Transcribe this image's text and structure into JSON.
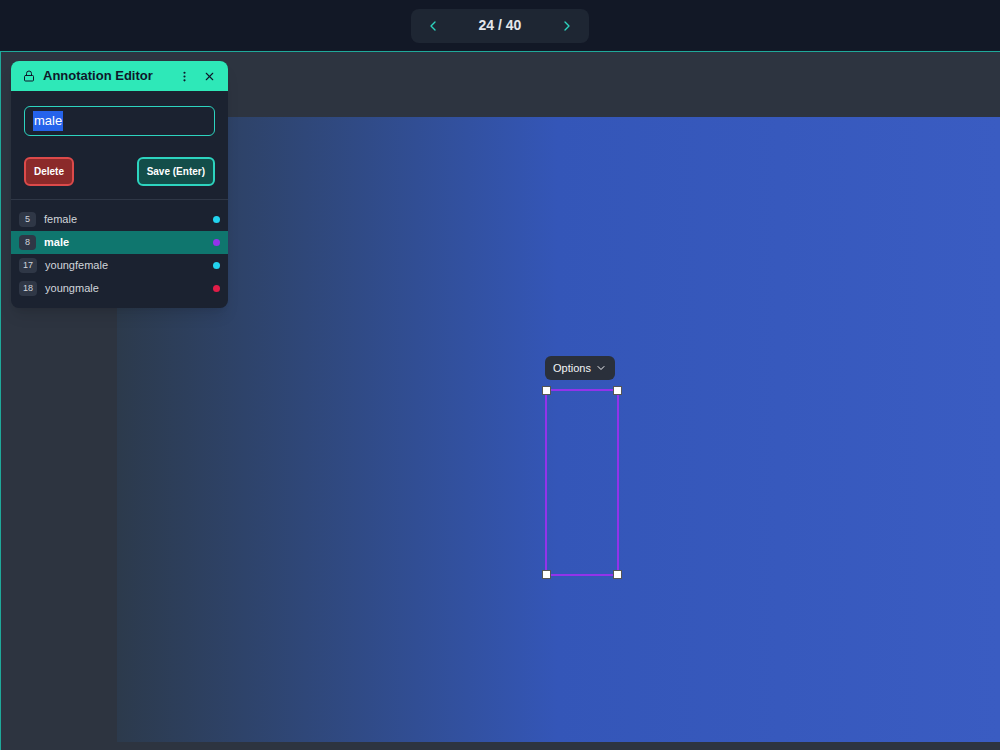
{
  "pager": {
    "text": "24 / 40"
  },
  "editor": {
    "title": "Annotation Editor",
    "value": "male",
    "value_selected": true,
    "buttons": [
      {
        "label": "Delete",
        "kind": "danger"
      },
      {
        "label": "Save (Enter)",
        "kind": "primary"
      }
    ],
    "labels": [
      {
        "count": "5",
        "name": "female",
        "selected": false,
        "color": "#22d3ee"
      },
      {
        "count": "8",
        "name": "male",
        "selected": true,
        "color": "#9333ea"
      },
      {
        "count": "17",
        "name": "youngfemale",
        "selected": false,
        "color": "#22d3ee"
      },
      {
        "count": "18",
        "name": "youngmale",
        "selected": false,
        "color": "#e11d48"
      }
    ]
  },
  "annotation": {
    "options_label": "Options",
    "selected": true,
    "color": "#9333ea"
  }
}
